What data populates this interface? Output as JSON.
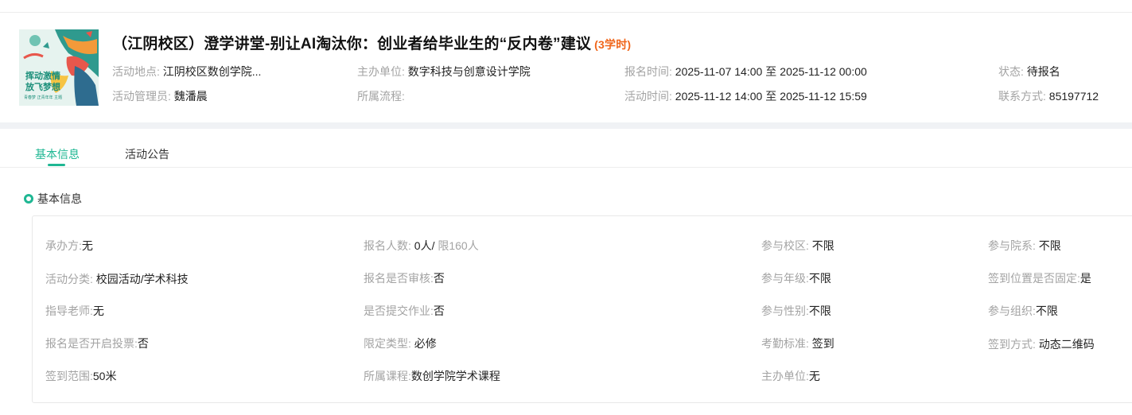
{
  "header": {
    "poster_text": {
      "line1": "挥动激情",
      "line2": "放飞梦想",
      "line3": "青春梦 正青年年 主题"
    },
    "title": "（江阴校区）澄学讲堂-别让AI淘汰你：创业者给毕业生的“反内卷”建议",
    "hours": "(3学时)",
    "meta": {
      "location_label": "活动地点:",
      "location_value": "江阴校区数创学院...",
      "manager_label": "活动管理员:",
      "manager_value": "魏潘晨",
      "organizer_label": "主办单位:",
      "organizer_value": "数字科技与创意设计学院",
      "process_label": "所属流程:",
      "process_value": "",
      "signup_time_label": "报名时间:",
      "signup_time_start": "2025-11-07 14:00",
      "signup_time_sep": "至",
      "signup_time_end": "2025-11-12 00:00",
      "activity_time_label": "活动时间:",
      "activity_time_start": "2025-11-12 14:00",
      "activity_time_sep": "至",
      "activity_time_end": "2025-11-12 15:59",
      "status_label": "状态:",
      "status_value": "待报名",
      "contact_label": "联系方式:",
      "contact_value": "85197712"
    }
  },
  "tabs": [
    {
      "label": "基本信息",
      "active": true
    },
    {
      "label": "活动公告",
      "active": false
    }
  ],
  "section": {
    "title": "基本信息"
  },
  "fields": {
    "undertaker_label": "承办方:",
    "undertaker_value": "无",
    "category_label": "活动分类:",
    "category_value": "校园活动/学术科技",
    "teacher_label": "指导老师:",
    "teacher_value": "无",
    "voting_label": "报名是否开启投票:",
    "voting_value": "否",
    "checkin_range_label": "签到范围:",
    "checkin_range_value": "50米",
    "enroll_count_label": "报名人数:",
    "enroll_count_value": "0人/",
    "enroll_limit": "限160人",
    "review_label": "报名是否审核:",
    "review_value": "否",
    "homework_label": "是否提交作业:",
    "homework_value": "否",
    "limit_type_label": "限定类型:",
    "limit_type_value": "必修",
    "course_label": "所属课程:",
    "course_value": "数创学院学术课程",
    "campus_label": "参与校区:",
    "campus_value": "不限",
    "grade_label": "参与年级:",
    "grade_value": "不限",
    "gender_label": "参与性别:",
    "gender_value": "不限",
    "attendance_label": "考勤标准:",
    "attendance_value": "签到",
    "host_label": "主办单位:",
    "host_value": "无",
    "department_label": "参与院系:",
    "department_value": "不限",
    "fixed_location_label": "签到位置是否固定:",
    "fixed_location_value": "是",
    "org_label": "参与组织:",
    "org_value": "不限",
    "checkin_method_label": "签到方式:",
    "checkin_method_value": "动态二维码"
  },
  "colors": {
    "accent": "#1fb793",
    "hours": "#f0661b",
    "label_gray": "#a3a3a3"
  }
}
